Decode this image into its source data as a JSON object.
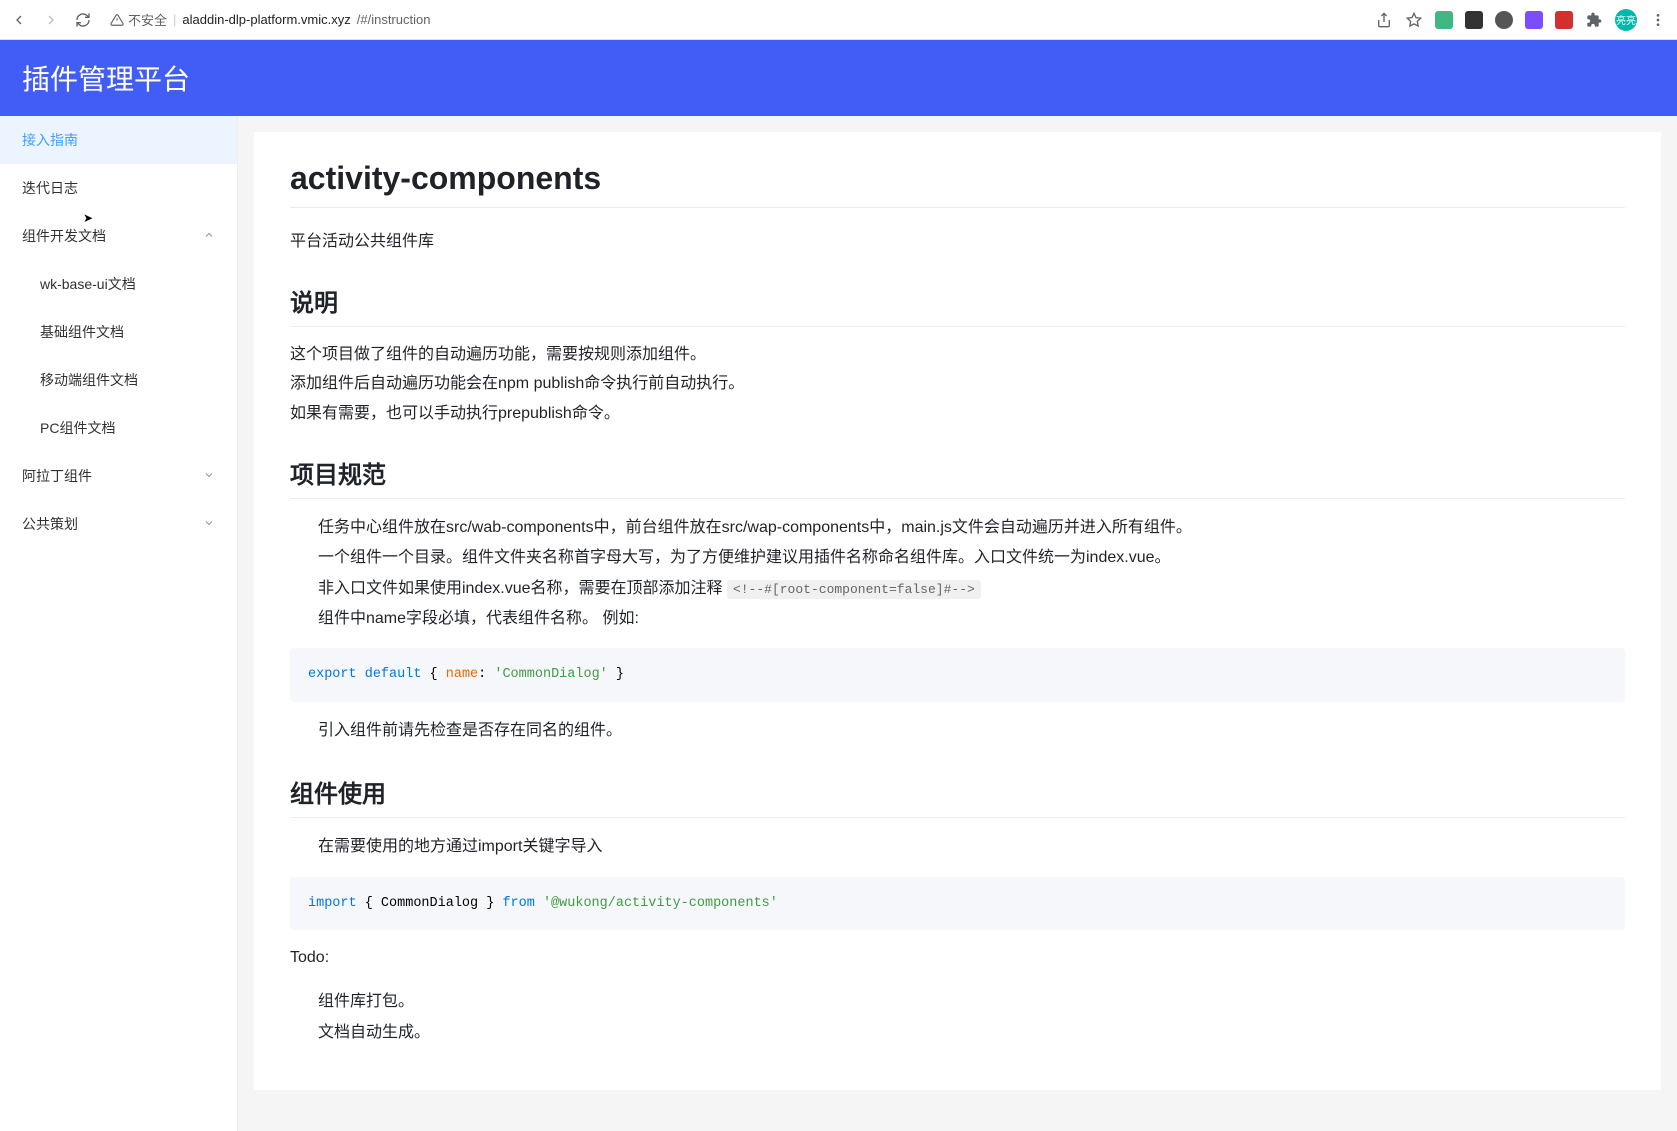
{
  "browser": {
    "insecure_label": "不安全",
    "url_host": "aladdin-dlp-platform.vmic.xyz",
    "url_path": "/#/instruction"
  },
  "header": {
    "title": "插件管理平台"
  },
  "sidebar": {
    "items": [
      {
        "label": "接入指南",
        "active": true,
        "expandable": false
      },
      {
        "label": "迭代日志",
        "active": false,
        "expandable": false
      },
      {
        "label": "组件开发文档",
        "active": false,
        "expandable": true,
        "expanded": true,
        "children": [
          {
            "label": "wk-base-ui文档"
          },
          {
            "label": "基础组件文档"
          },
          {
            "label": "移动端组件文档"
          },
          {
            "label": "PC组件文档"
          }
        ]
      },
      {
        "label": "阿拉丁组件",
        "active": false,
        "expandable": true,
        "expanded": false
      },
      {
        "label": "公共策划",
        "active": false,
        "expandable": true,
        "expanded": false
      }
    ]
  },
  "content": {
    "h1": "activity-components",
    "subtitle": "平台活动公共组件库",
    "section_desc": {
      "heading": "说明",
      "lines": [
        "这个项目做了组件的自动遍历功能，需要按规则添加组件。",
        "添加组件后自动遍历功能会在npm publish命令执行前自动执行。",
        "如果有需要，也可以手动执行prepublish命令。"
      ]
    },
    "section_spec": {
      "heading": "项目规范",
      "bullets": [
        "任务中心组件放在src/wab-components中，前台组件放在src/wap-components中，main.js文件会自动遍历并进入所有组件。",
        "一个组件一个目录。组件文件夹名称首字母大写，为了方便维护建议用插件名称命名组件库。入口文件统一为index.vue。",
        "非入口文件如果使用index.vue名称，需要在顶部添加注释 ",
        "组件中name字段必填，代表组件名称。 例如:"
      ],
      "comment_code": "<!--#[root-component=false]#-->",
      "code": {
        "kw1": "export",
        "kw2": "default",
        "brace_open": " {",
        "attr": "name",
        "colon": ": ",
        "str": "'CommonDialog'",
        "brace_close": "}"
      },
      "bullet_after": "引入组件前请先检查是否存在同名的组件。"
    },
    "section_usage": {
      "heading": "组件使用",
      "bullet": "在需要使用的地方通过import关键字导入",
      "code": {
        "kw1": "import",
        "mid": " { CommonDialog } ",
        "kw2": "from",
        "str": " '@wukong/activity-components'"
      }
    },
    "todo": {
      "label": "Todo:",
      "items": [
        "组件库打包。",
        "文档自动生成。"
      ]
    }
  }
}
